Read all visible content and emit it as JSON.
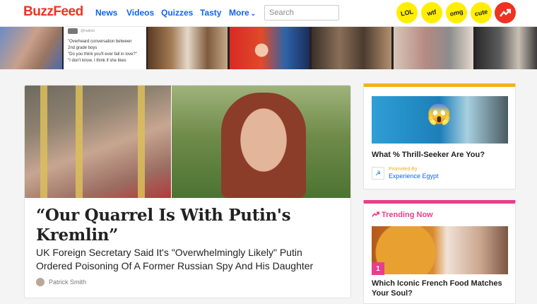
{
  "header": {
    "logo": "BuzzFeed",
    "nav": [
      "News",
      "Videos",
      "Quizzes",
      "Tasty"
    ],
    "more_label": "More",
    "search_placeholder": "Search",
    "badges": [
      "LOL",
      "wtf",
      "omg",
      "cute"
    ],
    "trend_icon": "trending-arrow-icon"
  },
  "strip": {
    "tweet_handle": "@hattieb",
    "tweet_lines": [
      "\"Overheard conversation between",
      "2nd grade boys",
      "\"Do you think you'll ever fall in love?\"",
      "\"I don't know. I think if she likes"
    ]
  },
  "main_story": {
    "headline": "“Our Quarrel Is With Putin's Kremlin”",
    "dek": "UK Foreign Secretary Said It's \"Overwhelmingly Likely\" Putin Ordered Poisoning Of A Former Russian Spy And His Daughter",
    "author": "Patrick Smith"
  },
  "promo": {
    "emoji": "😱",
    "title": "What % Thrill-Seeker Are You?",
    "promoted_label": "Promoted By",
    "brand": "Experience Egypt"
  },
  "trending": {
    "heading": "Trending Now",
    "rank": "1",
    "title": "Which Iconic French Food Matches Your Soul?"
  },
  "colors": {
    "brand_red": "#ee3322",
    "link_blue": "#0f65ef",
    "badge_yellow": "#ffee00",
    "promo_accent": "#f7b21a",
    "trending_pink": "#e83e8c"
  }
}
